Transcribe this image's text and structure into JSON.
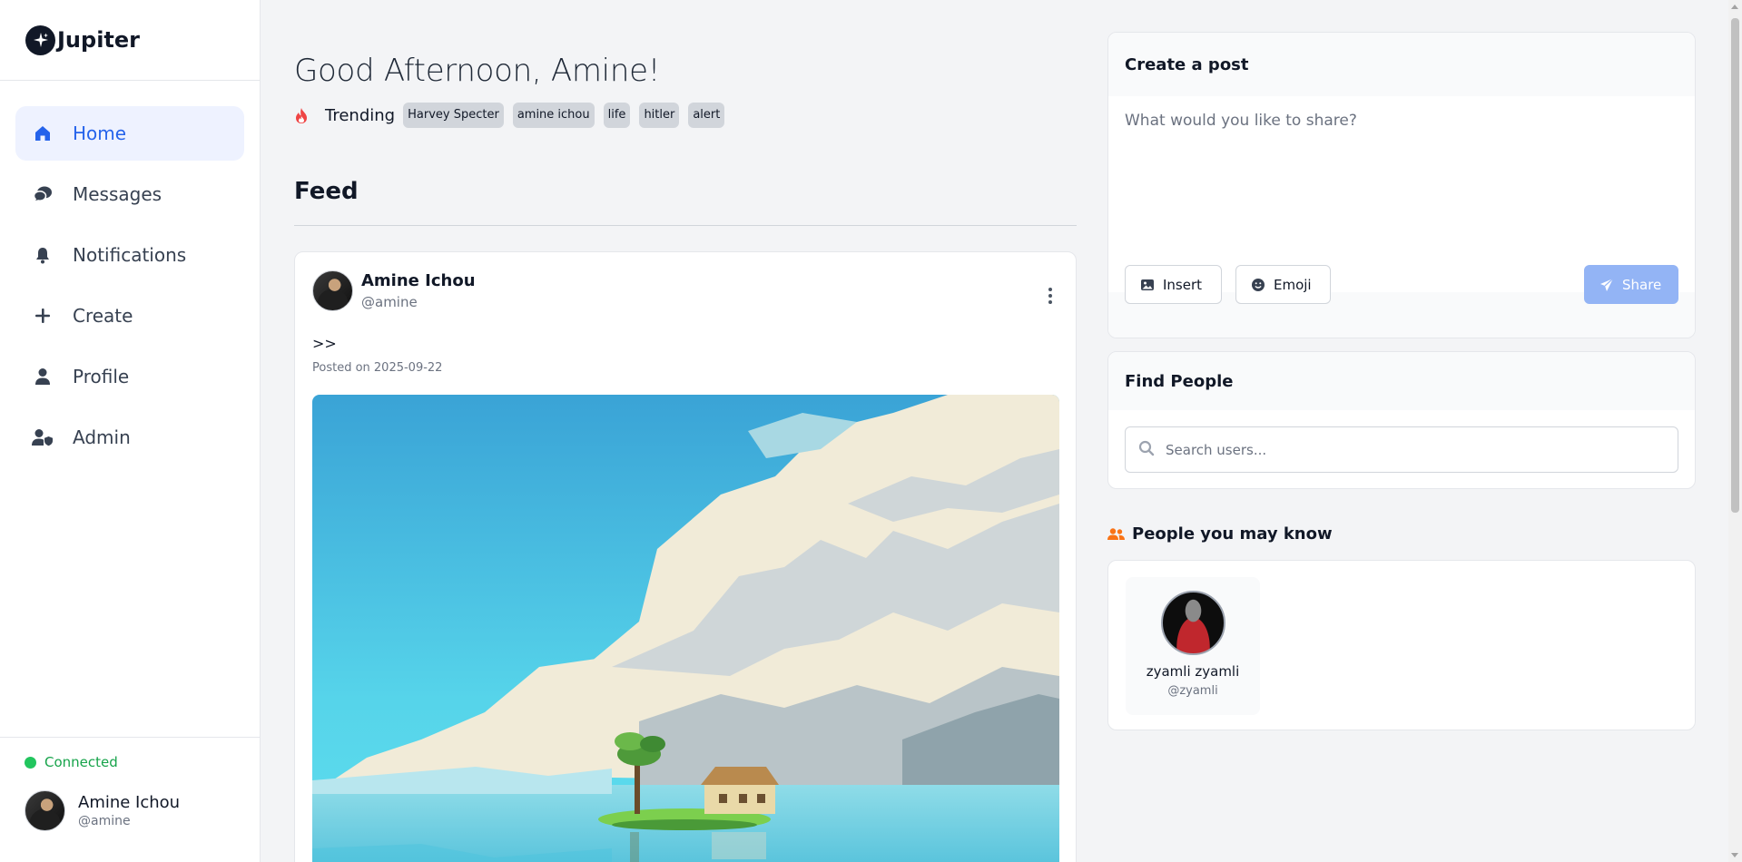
{
  "brand": {
    "name": "Jupiter",
    "icon": "sparkle-logo-icon"
  },
  "sidebar": {
    "items": [
      {
        "label": "Home",
        "icon": "home-icon",
        "active": true
      },
      {
        "label": "Messages",
        "icon": "chat-bubbles-icon",
        "active": false
      },
      {
        "label": "Notifications",
        "icon": "bell-icon",
        "active": false
      },
      {
        "label": "Create",
        "icon": "plus-icon",
        "active": false
      },
      {
        "label": "Profile",
        "icon": "user-icon",
        "active": false
      },
      {
        "label": "Admin",
        "icon": "user-shield-icon",
        "active": false
      }
    ],
    "status": "Connected",
    "user": {
      "name": "Amine Ichou",
      "handle": "@amine"
    }
  },
  "main": {
    "greeting": "Good Afternoon, Amine!",
    "trending_label": "Trending",
    "trending_tags": [
      "Harvey Specter",
      "amine ichou",
      "life",
      "hitler",
      "alert"
    ],
    "feed_title": "Feed",
    "post": {
      "author": "Amine Ichou",
      "handle": "@amine",
      "text": ">>",
      "date": "Posted on 2025-09-22",
      "image": "pixel-art-island-house-sky"
    }
  },
  "create_post": {
    "title": "Create a post",
    "placeholder": "What would you like to share?",
    "insert_label": "Insert",
    "emoji_label": "Emoji",
    "share_label": "Share"
  },
  "find_people": {
    "title": "Find People",
    "placeholder": "Search users..."
  },
  "people_you_may_know": {
    "title": "People you may know",
    "people": [
      {
        "name": "zyamli zyamli",
        "handle": "@zyamli"
      }
    ]
  },
  "colors": {
    "accent": "#2563eb",
    "active_bg": "#eef2ff",
    "connected": "#22c55e",
    "share_disabled": "#93b4f5",
    "fire": "#ef4444",
    "people_icon": "#f97316"
  }
}
